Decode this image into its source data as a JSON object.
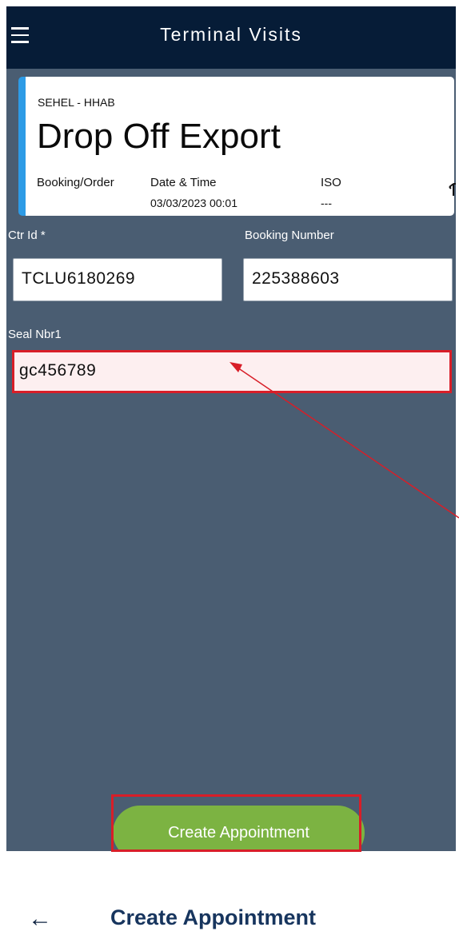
{
  "header": {
    "title": "Terminal Visits",
    "menu_icon": "hamburger-menu-icon"
  },
  "card": {
    "terminal": "SEHEL - HHAB",
    "appointment_type": "Drop Off Export",
    "booking_order_label": "Booking/Order",
    "date_time_label": "Date & Time",
    "date_time_value": "03/03/2023 00:01",
    "iso_label": "ISO",
    "iso_value": "---",
    "accent_color": "#2d9be6",
    "icon": "crane-icon"
  },
  "form": {
    "ctr_id_label": "Ctr Id *",
    "ctr_id_value": "TCLU6180269",
    "booking_number_label": "Booking Number",
    "booking_number_value": "225388603",
    "seal_label": "Seal Nbr1",
    "seal_value": "gc456789"
  },
  "actions": {
    "create_label": "Create Appointment",
    "button_color": "#7cb342"
  },
  "footer": {
    "back_icon": "back-arrow-icon",
    "back_glyph": "←",
    "title": "Create Appointment"
  },
  "annotation": {
    "highlight_color": "#d81e28"
  }
}
